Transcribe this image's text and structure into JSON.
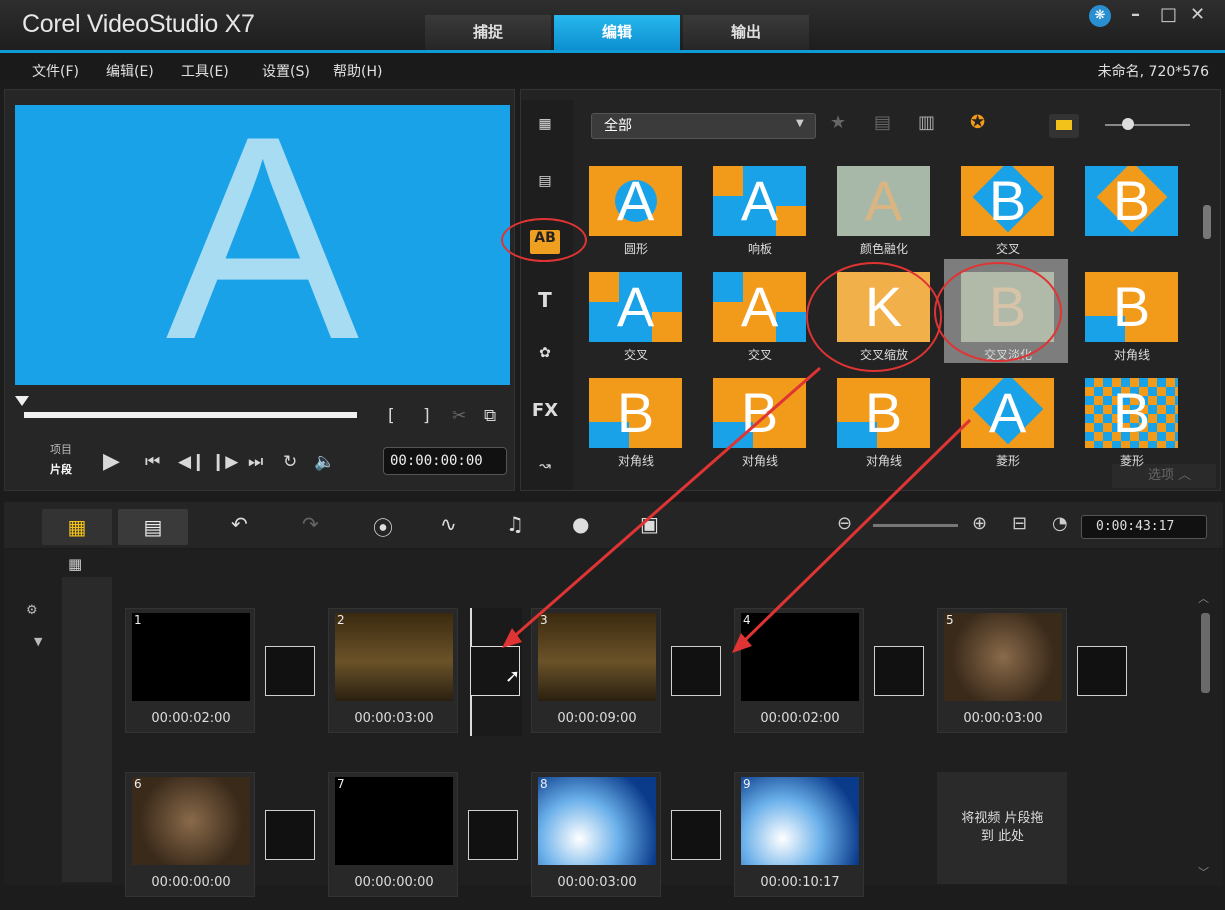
{
  "window": {
    "app_title": "Corel VideoStudio X7",
    "tabs": [
      "捕捉",
      "编辑",
      "输出"
    ],
    "active_tab": "编辑",
    "min": "–",
    "max": "□",
    "close": "✕"
  },
  "menu": {
    "items": [
      "文件(F)",
      "编辑(E)",
      "工具(E)",
      "设置(S)",
      "帮助(H)"
    ],
    "project_info": "未命名, 720*576"
  },
  "preview": {
    "letter": "A",
    "mode_project": "项目",
    "mode_clip": "片段",
    "timecode": "00:00:00:00",
    "bracket_in": "[",
    "bracket_out": "]"
  },
  "library": {
    "category": "全部",
    "fx_label": "FX",
    "options_label": "选项",
    "transitions": [
      {
        "label": "圆形"
      },
      {
        "label": "响板"
      },
      {
        "label": "颜色融化"
      },
      {
        "label": "交叉"
      },
      {
        "label": ""
      },
      {
        "label": "交叉"
      },
      {
        "label": "交叉"
      },
      {
        "label": "交叉缩放"
      },
      {
        "label": "交叉淡化"
      },
      {
        "label": "对角线"
      },
      {
        "label": "对角线"
      },
      {
        "label": "对角线"
      },
      {
        "label": "对角线"
      },
      {
        "label": "菱形"
      },
      {
        "label": "菱形"
      }
    ]
  },
  "timeline": {
    "duration": "0:00:43:17",
    "drop_hint": "将视频 片段拖到 此处",
    "clips": [
      {
        "num": "1",
        "time": "00:00:02:00"
      },
      {
        "num": "2",
        "time": "00:00:03:00"
      },
      {
        "num": "3",
        "time": "00:00:09:00"
      },
      {
        "num": "4",
        "time": "00:00:02:00"
      },
      {
        "num": "5",
        "time": "00:00:03:00"
      },
      {
        "num": "6",
        "time": "00:00:00:00"
      },
      {
        "num": "7",
        "time": "00:00:00:00"
      },
      {
        "num": "8",
        "time": "00:00:03:00"
      },
      {
        "num": "9",
        "time": "00:00:10:17"
      }
    ]
  },
  "colors": {
    "accent": "#0f9ad8",
    "annotation_red": "#e03434",
    "preview_bg": "#1aa2e8",
    "thumb_orange": "#f29a1a",
    "thumb_blue": "#1aa2e8"
  }
}
